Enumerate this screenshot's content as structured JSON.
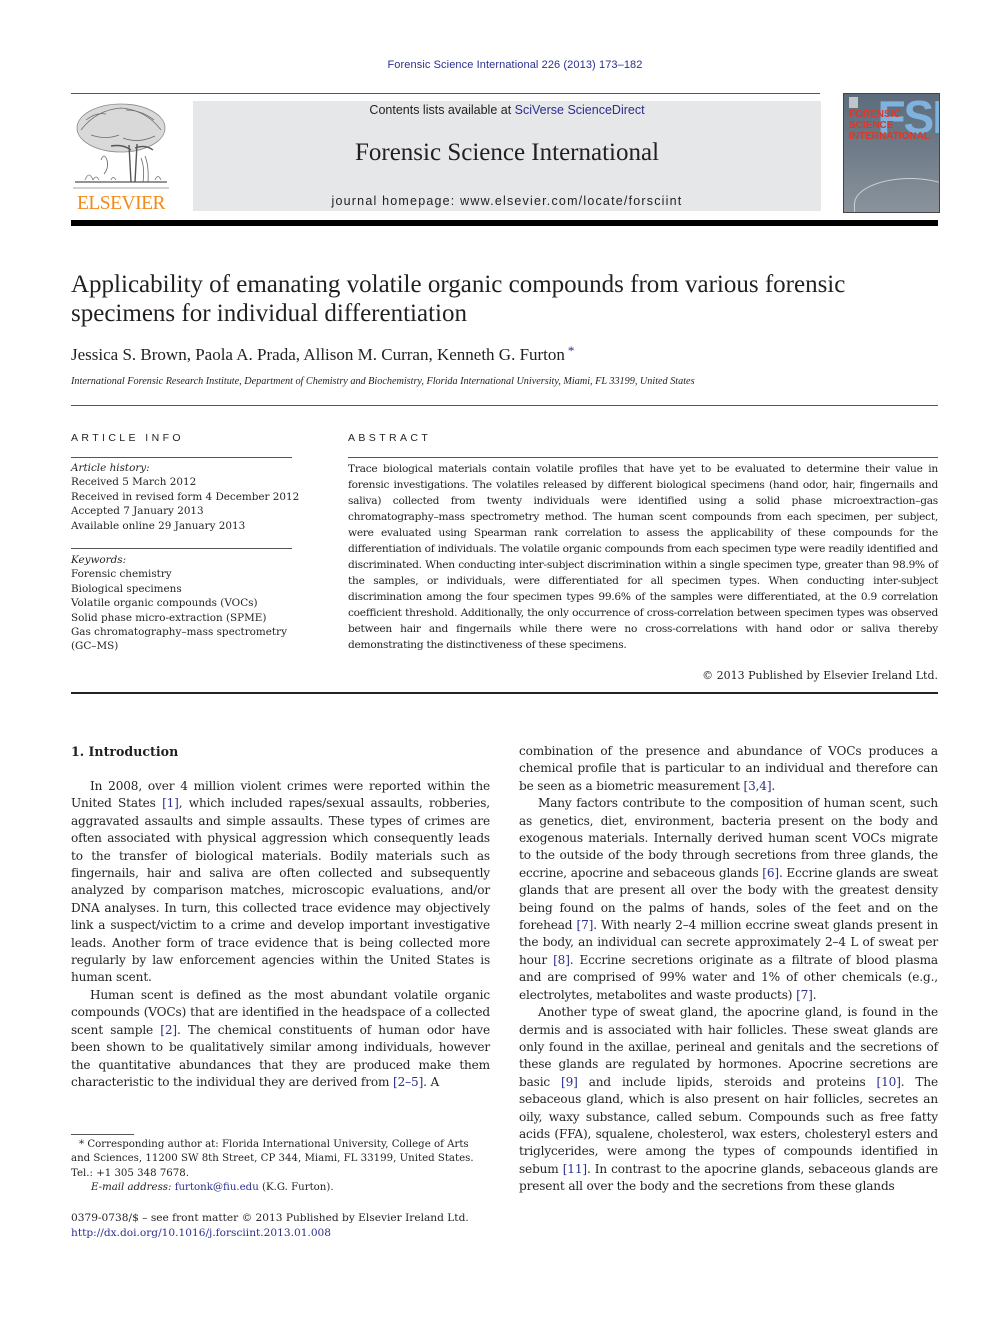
{
  "running_head": "Forensic Science International 226 (2013) 173–182",
  "masthead": {
    "publisher": "ELSEVIER",
    "contents_prefix": "Contents lists available at ",
    "contents_link": "SciVerse ScienceDirect",
    "journal_name": "Forensic Science International",
    "homepage": "journal homepage: www.elsevier.com/locate/forsciint",
    "cover": {
      "abbrev": "FSI",
      "title_lines": [
        "FORENSIC",
        "SCIENCE",
        "INTERNATIONAL"
      ]
    },
    "colors": {
      "publisher_orange": "#f28a1b",
      "link_blue": "#2b2f8f",
      "masthead_gray": "#e6e7e8"
    }
  },
  "article": {
    "title": "Applicability of emanating volatile organic compounds from various forensic specimens for individual differentiation",
    "authors": "Jessica S. Brown, Paola A. Prada, Allison M. Curran, Kenneth G. Furton",
    "corresponding_marker": "*",
    "affiliation": "International Forensic Research Institute, Department of Chemistry and Biochemistry, Florida International University, Miami, FL 33199, United States"
  },
  "article_info": {
    "heading": "ARTICLE INFO",
    "history_label": "Article history:",
    "history": [
      "Received 5 March 2012",
      "Received in revised form 4 December 2012",
      "Accepted 7 January 2013",
      "Available online 29 January 2013"
    ],
    "keywords_label": "Keywords:",
    "keywords": [
      "Forensic chemistry",
      "Biological specimens",
      "Volatile organic compounds (VOCs)",
      "Solid phase micro-extraction (SPME)",
      "Gas chromatography–mass spectrometry",
      "(GC–MS)"
    ]
  },
  "abstract": {
    "heading": "ABSTRACT",
    "text": "Trace biological materials contain volatile profiles that have yet to be evaluated to determine their value in forensic investigations. The volatiles released by different biological specimens (hand odor, hair, fingernails and saliva) collected from twenty individuals were identified using a solid phase microextraction–gas chromatography–mass spectrometry method. The human scent compounds from each specimen, per subject, were evaluated using Spearman rank correlation to assess the applicability of these compounds for the differentiation of individuals. The volatile organic compounds from each specimen type were readily identified and discriminated. When conducting inter-subject discrimination within a single specimen type, greater than 98.9% of the samples, or individuals, were differentiated for all specimen types. When conducting inter-subject discrimination among the four specimen types 99.6% of the samples were differentiated, at the 0.9 correlation coefficient threshold. Additionally, the only occurrence of cross-correlation between specimen types was observed between hair and fingernails while there were no cross-correlations with hand odor or saliva thereby demonstrating the distinctiveness of these specimens.",
    "copyright": "© 2013 Published by Elsevier Ireland Ltd."
  },
  "introduction": {
    "heading": "1.  Introduction",
    "left": [
      {
        "parts": [
          {
            "t": "In 2008, over 4 million violent crimes were reported within the United States "
          },
          {
            "ref": "[1]"
          },
          {
            "t": ", which included rapes/sexual assaults, robberies, aggravated assaults and simple assaults. These types of crimes are often associated with physical aggression which consequently leads to the transfer of biological materials. Bodily materials such as fingernails, hair and saliva are often collected and subsequently analyzed by comparison matches, microscopic evaluations, and/or DNA analyses. In turn, this collected trace evidence may objectively link a suspect/victim to a crime and develop important investigative leads. Another form of trace evidence that is being collected more regularly by law enforcement agencies within the United States is human scent."
          }
        ]
      },
      {
        "parts": [
          {
            "t": "Human scent is defined as the most abundant volatile organic compounds (VOCs) that are identified in the headspace of a collected scent sample "
          },
          {
            "ref": "[2]"
          },
          {
            "t": ". The chemical constituents of human odor have been shown to be qualitatively similar among individuals, however the quantitative abundances that they are produced make them characteristic to the individual they are derived from "
          },
          {
            "ref": "[2–5]"
          },
          {
            "t": ". A"
          }
        ]
      }
    ],
    "right": [
      {
        "noindent": true,
        "parts": [
          {
            "t": "combination of the presence and abundance of VOCs produces a chemical profile that is particular to an individual and therefore can be seen as a biometric measurement "
          },
          {
            "ref": "[3,4]"
          },
          {
            "t": "."
          }
        ]
      },
      {
        "parts": [
          {
            "t": "Many factors contribute to the composition of human scent, such as genetics, diet, environment, bacteria present on the body and exogenous materials. Internally derived human scent VOCs migrate to the outside of the body through secretions from three glands, the eccrine, apocrine and sebaceous glands "
          },
          {
            "ref": "[6]"
          },
          {
            "t": ". Eccrine glands are sweat glands that are present all over the body with the greatest density being found on the palms of hands, soles of the feet and on the forehead "
          },
          {
            "ref": "[7]"
          },
          {
            "t": ". With nearly 2–4 million eccrine sweat glands present in the body, an individual can secrete approximately 2–4 L of sweat per hour "
          },
          {
            "ref": "[8]"
          },
          {
            "t": ". Eccrine secretions originate as a filtrate of blood plasma and are comprised of 99% water and 1% of other chemicals (e.g., electrolytes, metabolites and waste products) "
          },
          {
            "ref": "[7]"
          },
          {
            "t": "."
          }
        ]
      },
      {
        "parts": [
          {
            "t": "Another type of sweat gland, the apocrine gland, is found in the dermis and is associated with hair follicles. These sweat glands are only found in the axillae, perineal and genitals and the secretions of these glands are regulated by hormones. Apocrine secretions are basic "
          },
          {
            "ref": "[9]"
          },
          {
            "t": " and include lipids, steroids and proteins "
          },
          {
            "ref": "[10]"
          },
          {
            "t": ". The sebaceous gland, which is also present on hair follicles, secretes an oily, waxy substance, called sebum. Compounds such as free fatty acids (FFA), squalene, cholesterol, wax esters, cholesteryl esters and triglycerides, were among the types of compounds identified in sebum "
          },
          {
            "ref": "[11]"
          },
          {
            "t": ". In contrast to the apocrine glands, sebaceous glands are present all over the body and the secretions from these glands"
          }
        ]
      }
    ]
  },
  "footnotes": {
    "corresponding": "* Corresponding author at: Florida International University, College of Arts and Sciences, 11200 SW 8th Street, CP 344, Miami, FL 33199, United States.",
    "tel": "Tel.: +1 305 348 7678.",
    "email_label": "E-mail address: ",
    "email": "furtonk@fiu.edu",
    "email_suffix": " (K.G. Furton).",
    "front_matter": "0379-0738/$ – see front matter © 2013 Published by Elsevier Ireland Ltd.",
    "doi": "http://dx.doi.org/10.1016/j.forsciint.2013.01.008"
  }
}
